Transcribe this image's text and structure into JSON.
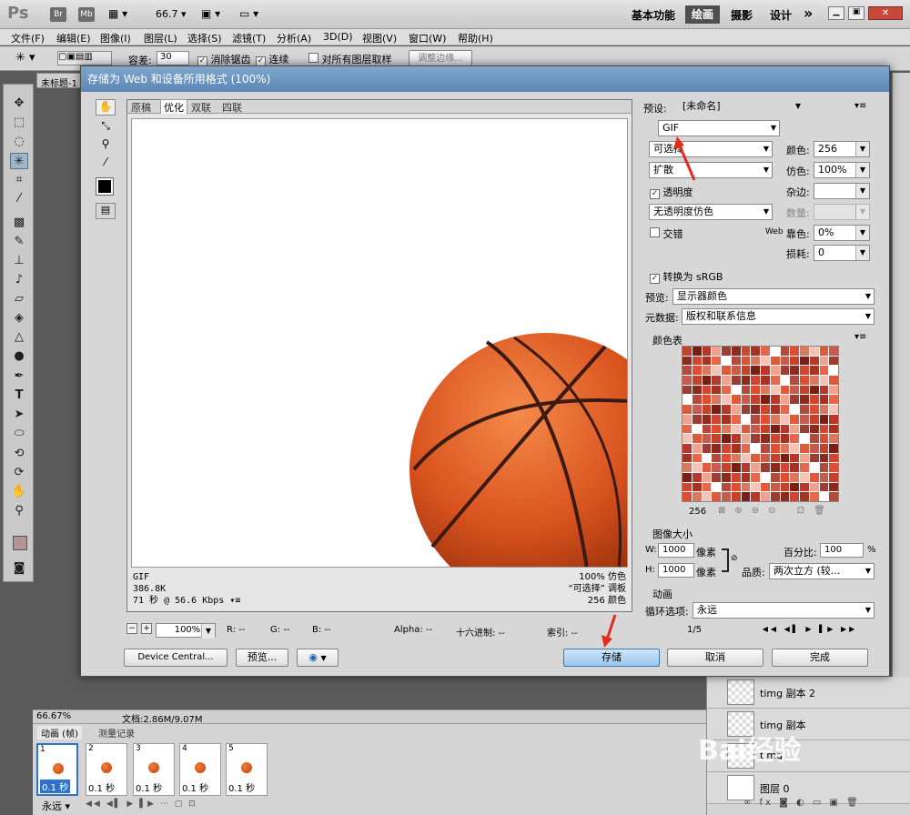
{
  "app": {
    "logo": "Ps",
    "bridge": "Br",
    "minibridge": "Mb",
    "zoom": "66.7",
    "workspaces": [
      "基本功能",
      "绘画",
      "摄影",
      "设计"
    ],
    "more": "»"
  },
  "menu": [
    "文件(F)",
    "编辑(E)",
    "图像(I)",
    "图层(L)",
    "选择(S)",
    "滤镜(T)",
    "分析(A)",
    "3D(D)",
    "视图(V)",
    "窗口(W)",
    "帮助(H)"
  ],
  "options": {
    "tolerance_label": "容差:",
    "tolerance_value": "30",
    "antialias": "消除锯齿",
    "contiguous": "连续",
    "all_layers": "对所有图层取样",
    "refine": "调整边缘..."
  },
  "doc_tab": "未标题-1",
  "dialog": {
    "title": "存储为 Web 和设备所用格式 (100%)",
    "tabs": [
      "原稿",
      "优化",
      "双联",
      "四联"
    ],
    "preview_info_left": [
      "GIF",
      "386.8K",
      "71 秒 @ 56.6 Kbps"
    ],
    "preview_info_right": [
      "100% 仿色",
      "“可选择” 调板",
      "256 颜色"
    ],
    "zoom_value": "100%",
    "readout": {
      "r": "R: --",
      "g": "G: --",
      "b": "B: --",
      "alpha": "Alpha: --",
      "hex": "十六进制: --",
      "index": "索引: --"
    },
    "device_central": "Device Central...",
    "preview_btn": "预览...",
    "save": "存储",
    "cancel": "取消",
    "done": "完成"
  },
  "settings": {
    "preset_label": "预设:",
    "preset_value": "[未命名]",
    "format": "GIF",
    "reduction": "可选择",
    "dither_algo": "扩散",
    "transparency": "透明度",
    "trans_dither": "无透明度仿色",
    "interlaced": "交错",
    "colors_label": "颜色:",
    "colors_value": "256",
    "dither_label": "仿色:",
    "dither_value": "100%",
    "matte_label": "杂边:",
    "amount_label": "数量:",
    "web_snap_prefix": "Web",
    "web_snap_label": "靠色:",
    "web_snap_value": "0%",
    "lossy_label": "损耗:",
    "lossy_value": "0",
    "convert_srgb": "转换为 sRGB",
    "preview_label": "预览:",
    "preview_value": "显示器颜色",
    "metadata_label": "元数据:",
    "metadata_value": "版权和联系信息",
    "color_table_label": "颜色表",
    "color_count": "256",
    "image_size_label": "图像大小",
    "w_label": "W:",
    "w_value": "1000",
    "h_label": "H:",
    "h_value": "1000",
    "px_unit": "像素",
    "percent_label": "百分比:",
    "percent_value": "100",
    "percent_unit": "%",
    "quality_label": "品质:",
    "quality_value": "两次立方 (较...",
    "animation_label": "动画",
    "loop_label": "循环选项:",
    "loop_value": "永远",
    "frame_counter": "1/5"
  },
  "status": {
    "zoom": "66.67%",
    "doc": "文档:2.86M/9.07M"
  },
  "anim_panel": {
    "tab_anim": "动画 (帧)",
    "tab_measure": "测量记录",
    "frames": [
      {
        "num": "1",
        "time": "0.1 秒"
      },
      {
        "num": "2",
        "time": "0.1 秒"
      },
      {
        "num": "3",
        "time": "0.1 秒"
      },
      {
        "num": "4",
        "time": "0.1 秒"
      },
      {
        "num": "5",
        "time": "0.1 秒"
      }
    ],
    "loop": "永远"
  },
  "layers": [
    "timg 副本 2",
    "timg 副本",
    "timg",
    "图层 0"
  ],
  "watermark": "Bai经验",
  "colors": {
    "accent": "#5c87b5",
    "active_ws": "#4f4f4f",
    "ball": "#d9531e"
  }
}
